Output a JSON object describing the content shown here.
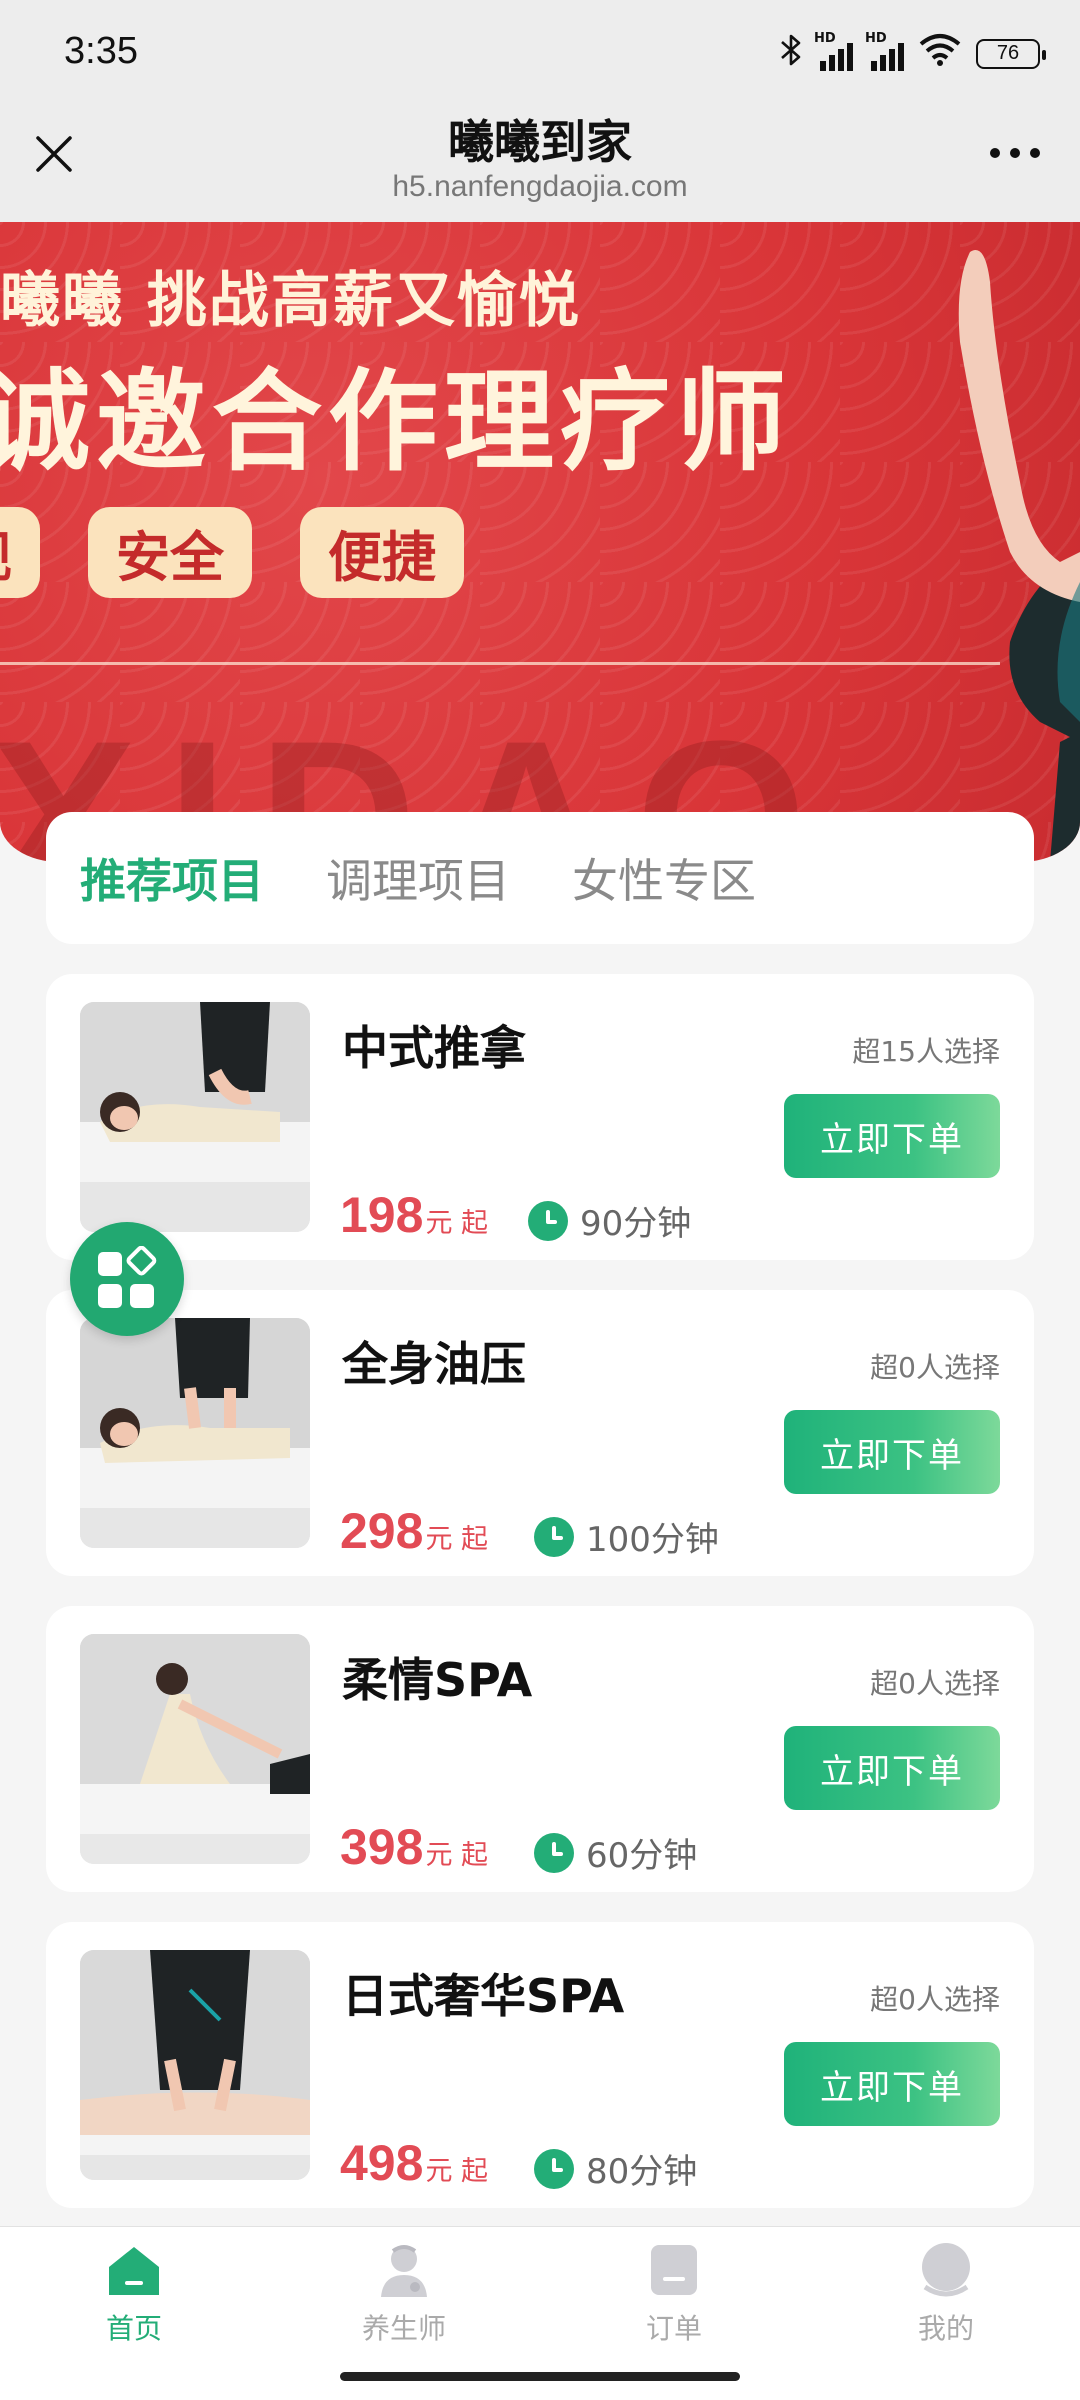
{
  "status_bar": {
    "time": "3:35",
    "bluetooth_icon": "bluetooth-icon",
    "signal_hd_1": "HD",
    "signal_hd_2": "HD",
    "wifi_icon": "wifi-icon",
    "battery": "76"
  },
  "title_bar": {
    "title": "曦曦到家",
    "url": "h5.nanfengdaojia.com",
    "close_icon": "close-icon",
    "more_icon": "more-dots-icon"
  },
  "banner": {
    "line1": "曦曦  挑战高薪又愉悦",
    "line2": "诚邀合作理疗师",
    "tags": [
      "规",
      "安全",
      "便捷"
    ],
    "watermark": "XIDAO"
  },
  "tabs": [
    {
      "label": "推荐项目",
      "active": true
    },
    {
      "label": "调理项目",
      "active": false
    },
    {
      "label": "女性专区",
      "active": false
    }
  ],
  "services": [
    {
      "name": "中式推拿",
      "sold": "超15人选择",
      "button": "立即下单",
      "price": "198",
      "unit": "元 起",
      "duration": "90分钟"
    },
    {
      "name": "全身油压",
      "sold": "超0人选择",
      "button": "立即下单",
      "price": "298",
      "unit": "元 起",
      "duration": "100分钟"
    },
    {
      "name": "柔情SPA",
      "sold": "超0人选择",
      "button": "立即下单",
      "price": "398",
      "unit": "元 起",
      "duration": "60分钟"
    },
    {
      "name": "日式奢华SPA",
      "sold": "超0人选择",
      "button": "立即下单",
      "price": "498",
      "unit": "元 起",
      "duration": "80分钟"
    }
  ],
  "bottom_nav": [
    {
      "label": "首页",
      "icon": "home-icon",
      "active": true
    },
    {
      "label": "养生师",
      "icon": "therapist-icon",
      "active": false
    },
    {
      "label": "订单",
      "icon": "order-icon",
      "active": false
    },
    {
      "label": "我的",
      "icon": "profile-icon",
      "active": false
    }
  ],
  "colors": {
    "accent_green": "#23ad77",
    "price_red": "#e24b55",
    "banner_red": "#d93538"
  }
}
